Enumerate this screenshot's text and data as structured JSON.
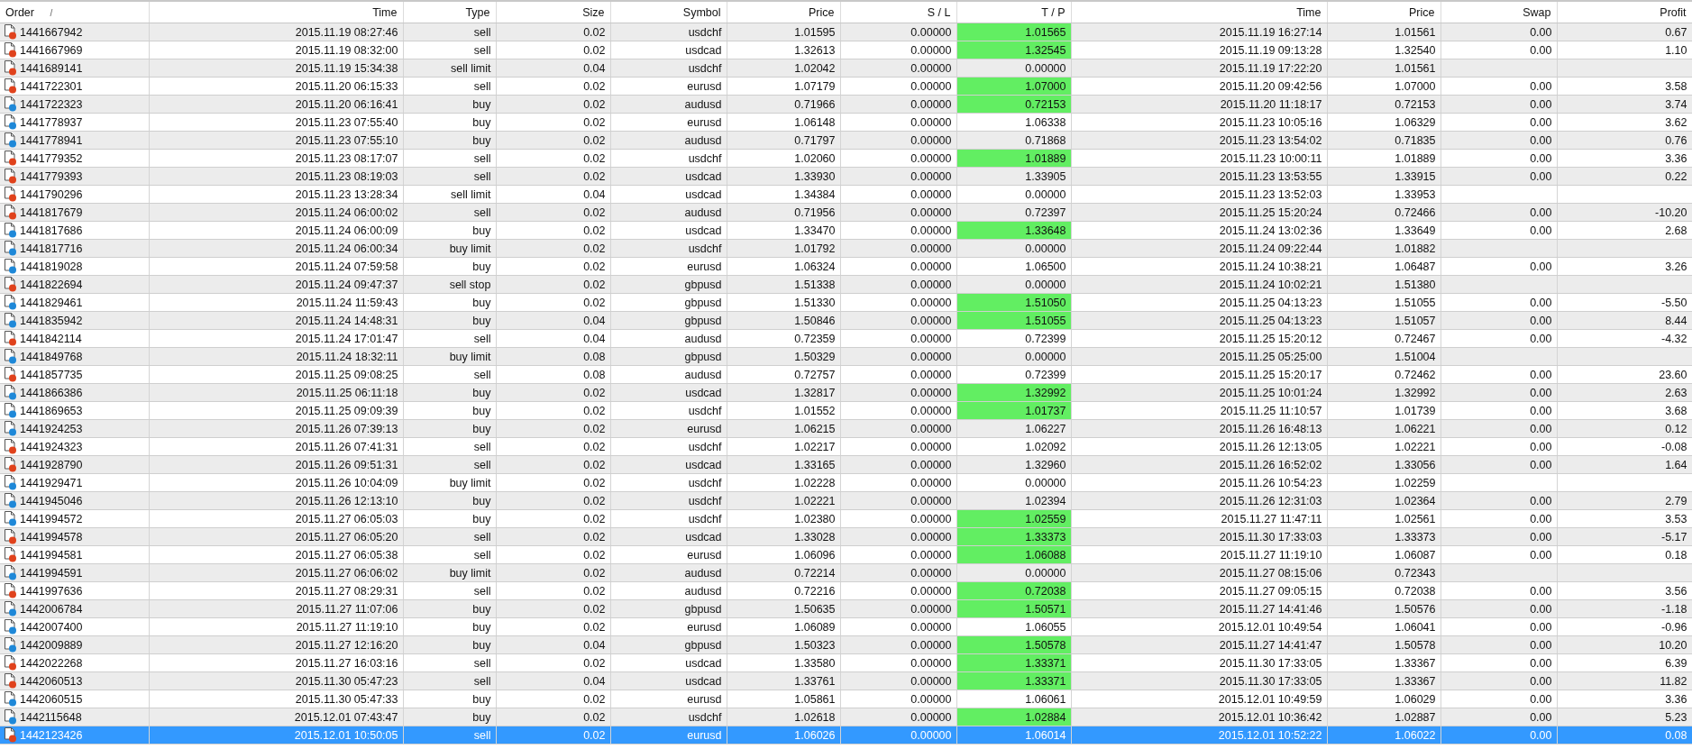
{
  "table": {
    "columns": [
      {
        "label": "Order",
        "sort_mark": "/"
      },
      {
        "label": "Time"
      },
      {
        "label": "Type"
      },
      {
        "label": "Size"
      },
      {
        "label": "Symbol"
      },
      {
        "label": "Price"
      },
      {
        "label": "S / L"
      },
      {
        "label": "T / P"
      },
      {
        "label": "Time"
      },
      {
        "label": "Price"
      },
      {
        "label": "Swap"
      },
      {
        "label": "Profit"
      }
    ],
    "rows": [
      {
        "kind": "sell",
        "order": "1441667942",
        "time": "2015.11.19 08:27:46",
        "type": "sell",
        "size": "0.02",
        "symbol": "usdchf",
        "price": "1.01595",
        "sl": "0.00000",
        "tp": "1.01565",
        "tp_hit": true,
        "close_time": "2015.11.19 16:27:14",
        "close_price": "1.01561",
        "swap": "0.00",
        "profit": "0.67",
        "selected": false
      },
      {
        "kind": "sell",
        "order": "1441667969",
        "time": "2015.11.19 08:32:00",
        "type": "sell",
        "size": "0.02",
        "symbol": "usdcad",
        "price": "1.32613",
        "sl": "0.00000",
        "tp": "1.32545",
        "tp_hit": true,
        "close_time": "2015.11.19 09:13:28",
        "close_price": "1.32540",
        "swap": "0.00",
        "profit": "1.10",
        "selected": false
      },
      {
        "kind": "sell",
        "order": "1441689141",
        "time": "2015.11.19 15:34:38",
        "type": "sell limit",
        "size": "0.04",
        "symbol": "usdchf",
        "price": "1.02042",
        "sl": "0.00000",
        "tp": "0.00000",
        "tp_hit": false,
        "close_time": "2015.11.19 17:22:20",
        "close_price": "1.01561",
        "selected": false
      },
      {
        "kind": "sell",
        "order": "1441722301",
        "time": "2015.11.20 06:15:33",
        "type": "sell",
        "size": "0.02",
        "symbol": "eurusd",
        "price": "1.07179",
        "sl": "0.00000",
        "tp": "1.07000",
        "tp_hit": true,
        "close_time": "2015.11.20 09:42:56",
        "close_price": "1.07000",
        "swap": "0.00",
        "profit": "3.58",
        "selected": false
      },
      {
        "kind": "buy",
        "order": "1441722323",
        "time": "2015.11.20 06:16:41",
        "type": "buy",
        "size": "0.02",
        "symbol": "audusd",
        "price": "0.71966",
        "sl": "0.00000",
        "tp": "0.72153",
        "tp_hit": true,
        "close_time": "2015.11.20 11:18:17",
        "close_price": "0.72153",
        "swap": "0.00",
        "profit": "3.74",
        "selected": false
      },
      {
        "kind": "buy",
        "order": "1441778937",
        "time": "2015.11.23 07:55:40",
        "type": "buy",
        "size": "0.02",
        "symbol": "eurusd",
        "price": "1.06148",
        "sl": "0.00000",
        "tp": "1.06338",
        "tp_hit": false,
        "close_time": "2015.11.23 10:05:16",
        "close_price": "1.06329",
        "swap": "0.00",
        "profit": "3.62",
        "selected": false
      },
      {
        "kind": "buy",
        "order": "1441778941",
        "time": "2015.11.23 07:55:10",
        "type": "buy",
        "size": "0.02",
        "symbol": "audusd",
        "price": "0.71797",
        "sl": "0.00000",
        "tp": "0.71868",
        "tp_hit": false,
        "close_time": "2015.11.23 13:54:02",
        "close_price": "0.71835",
        "swap": "0.00",
        "profit": "0.76",
        "selected": false
      },
      {
        "kind": "sell",
        "order": "1441779352",
        "time": "2015.11.23 08:17:07",
        "type": "sell",
        "size": "0.02",
        "symbol": "usdchf",
        "price": "1.02060",
        "sl": "0.00000",
        "tp": "1.01889",
        "tp_hit": true,
        "close_time": "2015.11.23 10:00:11",
        "close_price": "1.01889",
        "swap": "0.00",
        "profit": "3.36",
        "selected": false
      },
      {
        "kind": "sell",
        "order": "1441779393",
        "time": "2015.11.23 08:19:03",
        "type": "sell",
        "size": "0.02",
        "symbol": "usdcad",
        "price": "1.33930",
        "sl": "0.00000",
        "tp": "1.33905",
        "tp_hit": false,
        "close_time": "2015.11.23 13:53:55",
        "close_price": "1.33915",
        "swap": "0.00",
        "profit": "0.22",
        "selected": false
      },
      {
        "kind": "sell",
        "order": "1441790296",
        "time": "2015.11.23 13:28:34",
        "type": "sell limit",
        "size": "0.04",
        "symbol": "usdcad",
        "price": "1.34384",
        "sl": "0.00000",
        "tp": "0.00000",
        "tp_hit": false,
        "close_time": "2015.11.23 13:52:03",
        "close_price": "1.33953",
        "selected": false
      },
      {
        "kind": "sell",
        "order": "1441817679",
        "time": "2015.11.24 06:00:02",
        "type": "sell",
        "size": "0.02",
        "symbol": "audusd",
        "price": "0.71956",
        "sl": "0.00000",
        "tp": "0.72397",
        "tp_hit": false,
        "close_time": "2015.11.25 15:20:24",
        "close_price": "0.72466",
        "swap": "0.00",
        "profit": "-10.20",
        "selected": false
      },
      {
        "kind": "buy",
        "order": "1441817686",
        "time": "2015.11.24 06:00:09",
        "type": "buy",
        "size": "0.02",
        "symbol": "usdcad",
        "price": "1.33470",
        "sl": "0.00000",
        "tp": "1.33648",
        "tp_hit": true,
        "close_time": "2015.11.24 13:02:36",
        "close_price": "1.33649",
        "swap": "0.00",
        "profit": "2.68",
        "selected": false
      },
      {
        "kind": "buy",
        "order": "1441817716",
        "time": "2015.11.24 06:00:34",
        "type": "buy limit",
        "size": "0.02",
        "symbol": "usdchf",
        "price": "1.01792",
        "sl": "0.00000",
        "tp": "0.00000",
        "tp_hit": false,
        "close_time": "2015.11.24 09:22:44",
        "close_price": "1.01882",
        "selected": false
      },
      {
        "kind": "buy",
        "order": "1441819028",
        "time": "2015.11.24 07:59:58",
        "type": "buy",
        "size": "0.02",
        "symbol": "eurusd",
        "price": "1.06324",
        "sl": "0.00000",
        "tp": "1.06500",
        "tp_hit": false,
        "close_time": "2015.11.24 10:38:21",
        "close_price": "1.06487",
        "swap": "0.00",
        "profit": "3.26",
        "selected": false
      },
      {
        "kind": "sell",
        "order": "1441822694",
        "time": "2015.11.24 09:47:37",
        "type": "sell stop",
        "size": "0.02",
        "symbol": "gbpusd",
        "price": "1.51338",
        "sl": "0.00000",
        "tp": "0.00000",
        "tp_hit": false,
        "close_time": "2015.11.24 10:02:21",
        "close_price": "1.51380",
        "selected": false
      },
      {
        "kind": "buy",
        "order": "1441829461",
        "time": "2015.11.24 11:59:43",
        "type": "buy",
        "size": "0.02",
        "symbol": "gbpusd",
        "price": "1.51330",
        "sl": "0.00000",
        "tp": "1.51050",
        "tp_hit": true,
        "close_time": "2015.11.25 04:13:23",
        "close_price": "1.51055",
        "swap": "0.00",
        "profit": "-5.50",
        "selected": false
      },
      {
        "kind": "buy",
        "order": "1441835942",
        "time": "2015.11.24 14:48:31",
        "type": "buy",
        "size": "0.04",
        "symbol": "gbpusd",
        "price": "1.50846",
        "sl": "0.00000",
        "tp": "1.51055",
        "tp_hit": true,
        "close_time": "2015.11.25 04:13:23",
        "close_price": "1.51057",
        "swap": "0.00",
        "profit": "8.44",
        "selected": false
      },
      {
        "kind": "sell",
        "order": "1441842114",
        "time": "2015.11.24 17:01:47",
        "type": "sell",
        "size": "0.04",
        "symbol": "audusd",
        "price": "0.72359",
        "sl": "0.00000",
        "tp": "0.72399",
        "tp_hit": false,
        "close_time": "2015.11.25 15:20:12",
        "close_price": "0.72467",
        "swap": "0.00",
        "profit": "-4.32",
        "selected": false
      },
      {
        "kind": "buy",
        "order": "1441849768",
        "time": "2015.11.24 18:32:11",
        "type": "buy limit",
        "size": "0.08",
        "symbol": "gbpusd",
        "price": "1.50329",
        "sl": "0.00000",
        "tp": "0.00000",
        "tp_hit": false,
        "close_time": "2015.11.25 05:25:00",
        "close_price": "1.51004",
        "selected": false
      },
      {
        "kind": "sell",
        "order": "1441857735",
        "time": "2015.11.25 09:08:25",
        "type": "sell",
        "size": "0.08",
        "symbol": "audusd",
        "price": "0.72757",
        "sl": "0.00000",
        "tp": "0.72399",
        "tp_hit": false,
        "close_time": "2015.11.25 15:20:17",
        "close_price": "0.72462",
        "swap": "0.00",
        "profit": "23.60",
        "selected": false
      },
      {
        "kind": "buy",
        "order": "1441866386",
        "time": "2015.11.25 06:11:18",
        "type": "buy",
        "size": "0.02",
        "symbol": "usdcad",
        "price": "1.32817",
        "sl": "0.00000",
        "tp": "1.32992",
        "tp_hit": true,
        "close_time": "2015.11.25 10:01:24",
        "close_price": "1.32992",
        "swap": "0.00",
        "profit": "2.63",
        "selected": false
      },
      {
        "kind": "buy",
        "order": "1441869653",
        "time": "2015.11.25 09:09:39",
        "type": "buy",
        "size": "0.02",
        "symbol": "usdchf",
        "price": "1.01552",
        "sl": "0.00000",
        "tp": "1.01737",
        "tp_hit": true,
        "close_time": "2015.11.25 11:10:57",
        "close_price": "1.01739",
        "swap": "0.00",
        "profit": "3.68",
        "selected": false
      },
      {
        "kind": "buy",
        "order": "1441924253",
        "time": "2015.11.26 07:39:13",
        "type": "buy",
        "size": "0.02",
        "symbol": "eurusd",
        "price": "1.06215",
        "sl": "0.00000",
        "tp": "1.06227",
        "tp_hit": false,
        "close_time": "2015.11.26 16:48:13",
        "close_price": "1.06221",
        "swap": "0.00",
        "profit": "0.12",
        "selected": false
      },
      {
        "kind": "sell",
        "order": "1441924323",
        "time": "2015.11.26 07:41:31",
        "type": "sell",
        "size": "0.02",
        "symbol": "usdchf",
        "price": "1.02217",
        "sl": "0.00000",
        "tp": "1.02092",
        "tp_hit": false,
        "close_time": "2015.11.26 12:13:05",
        "close_price": "1.02221",
        "swap": "0.00",
        "profit": "-0.08",
        "selected": false
      },
      {
        "kind": "sell",
        "order": "1441928790",
        "time": "2015.11.26 09:51:31",
        "type": "sell",
        "size": "0.02",
        "symbol": "usdcad",
        "price": "1.33165",
        "sl": "0.00000",
        "tp": "1.32960",
        "tp_hit": false,
        "close_time": "2015.11.26 16:52:02",
        "close_price": "1.33056",
        "swap": "0.00",
        "profit": "1.64",
        "selected": false
      },
      {
        "kind": "buy",
        "order": "1441929471",
        "time": "2015.11.26 10:04:09",
        "type": "buy limit",
        "size": "0.02",
        "symbol": "usdchf",
        "price": "1.02228",
        "sl": "0.00000",
        "tp": "0.00000",
        "tp_hit": false,
        "close_time": "2015.11.26 10:54:23",
        "close_price": "1.02259",
        "selected": false
      },
      {
        "kind": "buy",
        "order": "1441945046",
        "time": "2015.11.26 12:13:10",
        "type": "buy",
        "size": "0.02",
        "symbol": "usdchf",
        "price": "1.02221",
        "sl": "0.00000",
        "tp": "1.02394",
        "tp_hit": false,
        "close_time": "2015.11.26 12:31:03",
        "close_price": "1.02364",
        "swap": "0.00",
        "profit": "2.79",
        "selected": false
      },
      {
        "kind": "buy",
        "order": "1441994572",
        "time": "2015.11.27 06:05:03",
        "type": "buy",
        "size": "0.02",
        "symbol": "usdchf",
        "price": "1.02380",
        "sl": "0.00000",
        "tp": "1.02559",
        "tp_hit": true,
        "close_time": "2015.11.27 11:47:11",
        "close_price": "1.02561",
        "swap": "0.00",
        "profit": "3.53",
        "selected": false
      },
      {
        "kind": "sell",
        "order": "1441994578",
        "time": "2015.11.27 06:05:20",
        "type": "sell",
        "size": "0.02",
        "symbol": "usdcad",
        "price": "1.33028",
        "sl": "0.00000",
        "tp": "1.33373",
        "tp_hit": true,
        "close_time": "2015.11.30 17:33:03",
        "close_price": "1.33373",
        "swap": "0.00",
        "profit": "-5.17",
        "selected": false
      },
      {
        "kind": "sell",
        "order": "1441994581",
        "time": "2015.11.27 06:05:38",
        "type": "sell",
        "size": "0.02",
        "symbol": "eurusd",
        "price": "1.06096",
        "sl": "0.00000",
        "tp": "1.06088",
        "tp_hit": true,
        "close_time": "2015.11.27 11:19:10",
        "close_price": "1.06087",
        "swap": "0.00",
        "profit": "0.18",
        "selected": false
      },
      {
        "kind": "buy",
        "order": "1441994591",
        "time": "2015.11.27 06:06:02",
        "type": "buy limit",
        "size": "0.02",
        "symbol": "audusd",
        "price": "0.72214",
        "sl": "0.00000",
        "tp": "0.00000",
        "tp_hit": false,
        "close_time": "2015.11.27 08:15:06",
        "close_price": "0.72343",
        "selected": false
      },
      {
        "kind": "sell",
        "order": "1441997636",
        "time": "2015.11.27 08:29:31",
        "type": "sell",
        "size": "0.02",
        "symbol": "audusd",
        "price": "0.72216",
        "sl": "0.00000",
        "tp": "0.72038",
        "tp_hit": true,
        "close_time": "2015.11.27 09:05:15",
        "close_price": "0.72038",
        "swap": "0.00",
        "profit": "3.56",
        "selected": false
      },
      {
        "kind": "buy",
        "order": "1442006784",
        "time": "2015.11.27 11:07:06",
        "type": "buy",
        "size": "0.02",
        "symbol": "gbpusd",
        "price": "1.50635",
        "sl": "0.00000",
        "tp": "1.50571",
        "tp_hit": true,
        "close_time": "2015.11.27 14:41:46",
        "close_price": "1.50576",
        "swap": "0.00",
        "profit": "-1.18",
        "selected": false
      },
      {
        "kind": "buy",
        "order": "1442007400",
        "time": "2015.11.27 11:19:10",
        "type": "buy",
        "size": "0.02",
        "symbol": "eurusd",
        "price": "1.06089",
        "sl": "0.00000",
        "tp": "1.06055",
        "tp_hit": false,
        "close_time": "2015.12.01 10:49:54",
        "close_price": "1.06041",
        "swap": "0.00",
        "profit": "-0.96",
        "selected": false
      },
      {
        "kind": "buy",
        "order": "1442009889",
        "time": "2015.11.27 12:16:20",
        "type": "buy",
        "size": "0.04",
        "symbol": "gbpusd",
        "price": "1.50323",
        "sl": "0.00000",
        "tp": "1.50578",
        "tp_hit": true,
        "close_time": "2015.11.27 14:41:47",
        "close_price": "1.50578",
        "swap": "0.00",
        "profit": "10.20",
        "selected": false
      },
      {
        "kind": "sell",
        "order": "1442022268",
        "time": "2015.11.27 16:03:16",
        "type": "sell",
        "size": "0.02",
        "symbol": "usdcad",
        "price": "1.33580",
        "sl": "0.00000",
        "tp": "1.33371",
        "tp_hit": true,
        "close_time": "2015.11.30 17:33:05",
        "close_price": "1.33367",
        "swap": "0.00",
        "profit": "6.39",
        "selected": false
      },
      {
        "kind": "sell",
        "order": "1442060513",
        "time": "2015.11.30 05:47:23",
        "type": "sell",
        "size": "0.04",
        "symbol": "usdcad",
        "price": "1.33761",
        "sl": "0.00000",
        "tp": "1.33371",
        "tp_hit": true,
        "close_time": "2015.11.30 17:33:05",
        "close_price": "1.33367",
        "swap": "0.00",
        "profit": "11.82",
        "selected": false
      },
      {
        "kind": "buy",
        "order": "1442060515",
        "time": "2015.11.30 05:47:33",
        "type": "buy",
        "size": "0.02",
        "symbol": "eurusd",
        "price": "1.05861",
        "sl": "0.00000",
        "tp": "1.06061",
        "tp_hit": false,
        "close_time": "2015.12.01 10:49:59",
        "close_price": "1.06029",
        "swap": "0.00",
        "profit": "3.36",
        "selected": false
      },
      {
        "kind": "buy",
        "order": "1442115648",
        "time": "2015.12.01 07:43:47",
        "type": "buy",
        "size": "0.02",
        "symbol": "usdchf",
        "price": "1.02618",
        "sl": "0.00000",
        "tp": "1.02884",
        "tp_hit": true,
        "close_time": "2015.12.01 10:36:42",
        "close_price": "1.02887",
        "swap": "0.00",
        "profit": "5.23",
        "selected": false
      },
      {
        "kind": "sell",
        "order": "1442123426",
        "time": "2015.12.01 10:50:05",
        "type": "sell",
        "size": "0.02",
        "symbol": "eurusd",
        "price": "1.06026",
        "sl": "0.00000",
        "tp": "1.06014",
        "tp_hit": false,
        "close_time": "2015.12.01 10:52:22",
        "close_price": "1.06022",
        "swap": "0.00",
        "profit": "0.08",
        "selected": true
      }
    ]
  }
}
